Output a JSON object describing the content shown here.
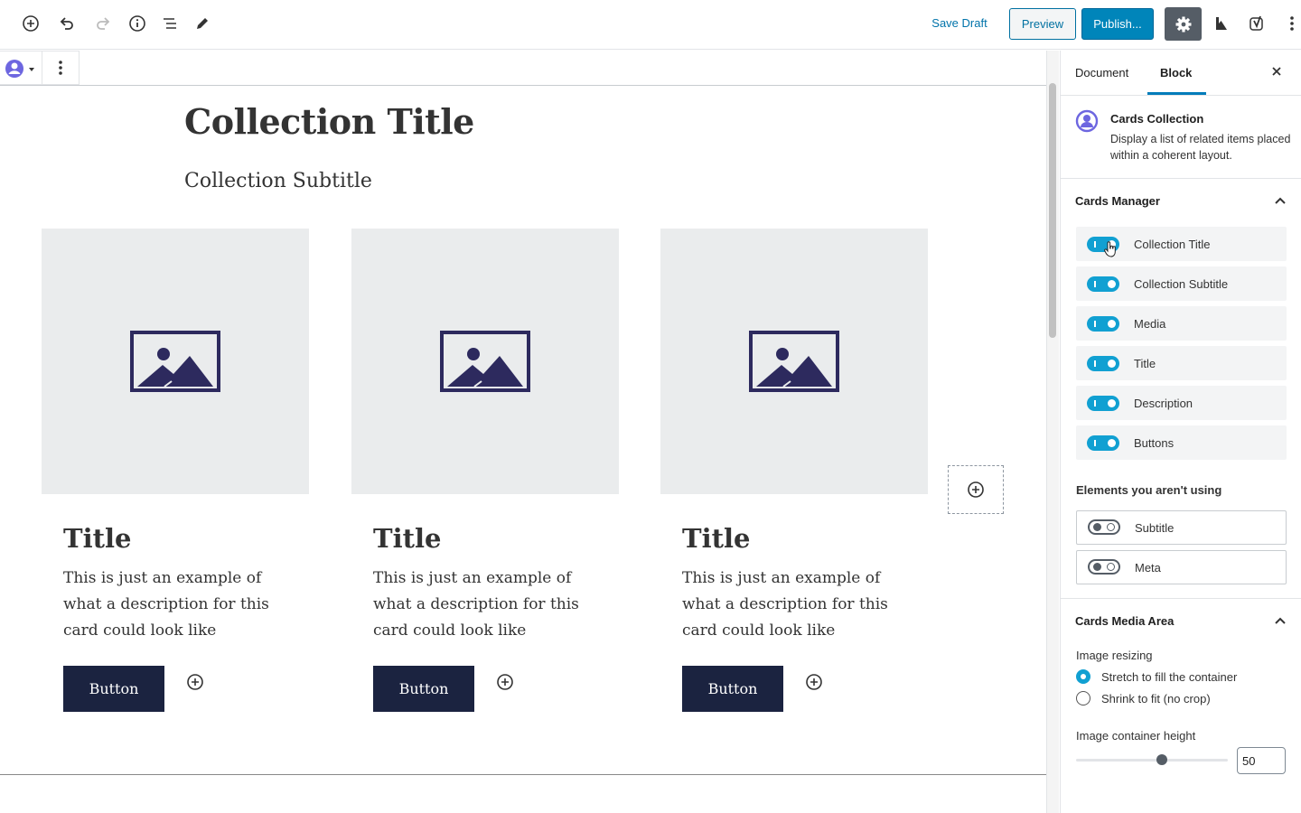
{
  "toolbar": {
    "save_draft": "Save Draft",
    "preview": "Preview",
    "publish": "Publish..."
  },
  "content": {
    "collection_title": "Collection Title",
    "collection_subtitle": "Collection Subtitle",
    "cards": [
      {
        "title": "Title",
        "description": "This is just an example of what a description for this card could look like",
        "button": "Button"
      },
      {
        "title": "Title",
        "description": "This is just an example of what a description for this card could look like",
        "button": "Button"
      },
      {
        "title": "Title",
        "description": "This is just an example of what a description for this card could look like",
        "button": "Button"
      }
    ]
  },
  "sidebar": {
    "tabs": [
      "Document",
      "Block"
    ],
    "active_tab": "Block",
    "block_name": "Cards Collection",
    "block_description": "Display a list of related items placed within a coherent layout.",
    "cards_manager": {
      "heading": "Cards Manager",
      "enabled": [
        "Collection Title",
        "Collection Subtitle",
        "Media",
        "Title",
        "Description",
        "Buttons"
      ],
      "unused_heading": "Elements you aren't using",
      "unused": [
        "Subtitle",
        "Meta"
      ]
    },
    "media_area": {
      "heading": "Cards Media Area",
      "resizing_label": "Image resizing",
      "options": [
        "Stretch to fill the container",
        "Shrink to fit (no crop)"
      ],
      "selected_option": "Stretch to fill the container",
      "height_label": "Image container height",
      "height_value": "50",
      "height_fraction": 0.5
    }
  },
  "colors": {
    "accent": "#0085ba",
    "toggle_on": "#11a0d2",
    "card_button": "#1b2340",
    "image_icon": "#2d2a5e"
  }
}
